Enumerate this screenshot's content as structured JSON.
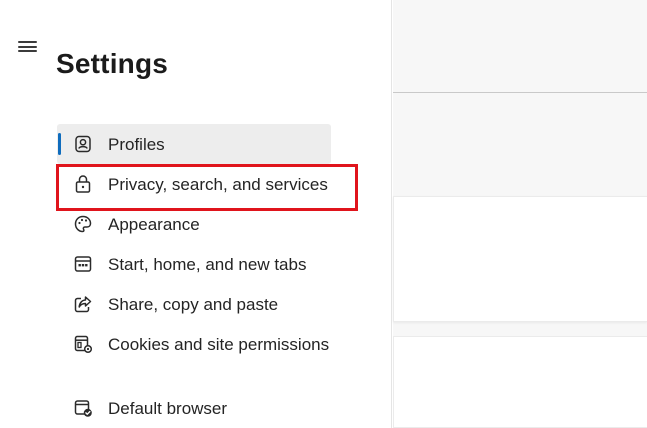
{
  "header": {
    "title": "Settings",
    "menu_icon": "hamburger-menu-icon"
  },
  "sidebar": {
    "items": [
      {
        "label": "Profiles",
        "icon": "profile-icon",
        "selected": true
      },
      {
        "label": "Privacy, search, and services",
        "icon": "lock-icon",
        "selected": false,
        "highlighted": true
      },
      {
        "label": "Appearance",
        "icon": "palette-icon",
        "selected": false
      },
      {
        "label": "Start, home, and new tabs",
        "icon": "new-tab-icon",
        "selected": false
      },
      {
        "label": "Share, copy and paste",
        "icon": "share-icon",
        "selected": false
      },
      {
        "label": "Cookies and site permissions",
        "icon": "cookies-permissions-icon",
        "selected": false
      },
      {
        "label": "Default browser",
        "icon": "default-browser-icon",
        "selected": false
      }
    ]
  },
  "colors": {
    "accent": "#0f6cbd",
    "highlight_border": "#e0141c",
    "selected_background": "#ededed",
    "content_background": "#f7f7f7"
  }
}
